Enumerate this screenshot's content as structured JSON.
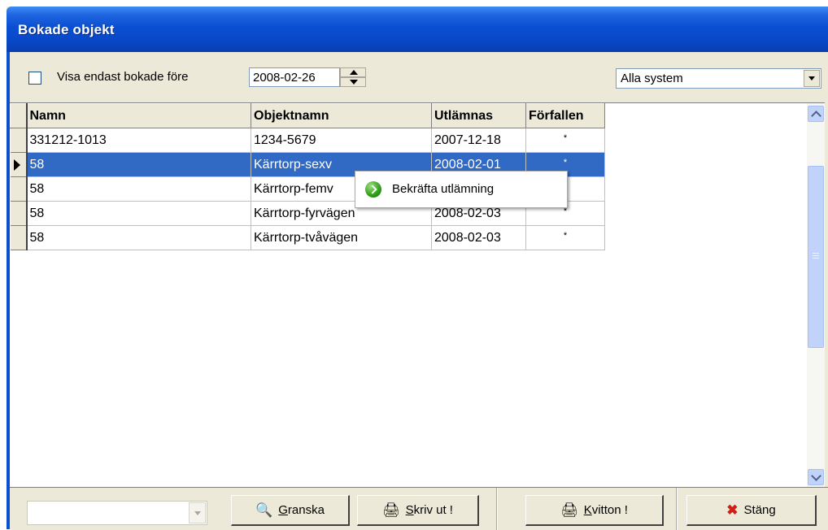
{
  "window": {
    "title": "Bokade objekt"
  },
  "toolbar": {
    "checkbox_label": "Visa endast bokade före",
    "date_value": "2008-02-26",
    "system_selected": "Alla system"
  },
  "grid": {
    "columns": [
      "Namn",
      "Objektnamn",
      "Utlämnas",
      "Förfallen"
    ],
    "rows": [
      {
        "namn": "331212-1013",
        "objektnamn": "1234-5679",
        "utlamnas": "2007-12-18",
        "forfallen": "*"
      },
      {
        "namn": "58",
        "objektnamn": "Kärrtorp-sexv",
        "utlamnas": "2008-02-01",
        "forfallen": "*"
      },
      {
        "namn": "58",
        "objektnamn": "Kärrtorp-femv",
        "utlamnas": "",
        "forfallen": "*"
      },
      {
        "namn": "58",
        "objektnamn": "Kärrtorp-fyrvägen",
        "utlamnas": "2008-02-03",
        "forfallen": "*"
      },
      {
        "namn": "58",
        "objektnamn": "Kärrtorp-tvåvägen",
        "utlamnas": "2008-02-03",
        "forfallen": "*"
      }
    ]
  },
  "context_menu": {
    "item_label": "Bekräfta utlämning",
    "item_icon": "green-arrow-icon"
  },
  "bottom": {
    "select_value": "",
    "granska_prefix": "",
    "granska_u": "G",
    "granska_rest": "ranska",
    "skriv_u": "S",
    "skriv_rest": "kriv ut !",
    "kvitton_u": "K",
    "kvitton_rest": "vitton !",
    "stang_label": "Stäng"
  },
  "colors": {
    "selection": "#316ac5",
    "titlebar": "#0a4fd2",
    "close_icon": "#d21e14"
  }
}
